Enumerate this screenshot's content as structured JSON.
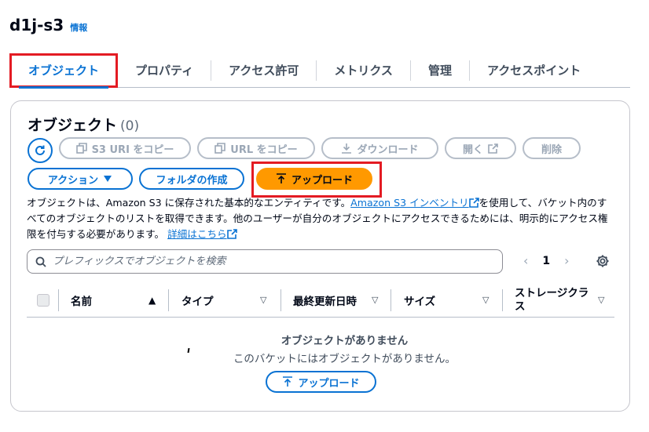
{
  "bucket": {
    "name": "d1j-s3",
    "info_label": "情報"
  },
  "tabs": [
    {
      "label": "オブジェクト",
      "active": true
    },
    {
      "label": "プロパティ"
    },
    {
      "label": "アクセス許可"
    },
    {
      "label": "メトリクス"
    },
    {
      "label": "管理"
    },
    {
      "label": "アクセスポイント"
    }
  ],
  "objects_panel": {
    "title": "オブジェクト",
    "count": "(0)",
    "buttons": {
      "copy_s3_uri": "S3 URI をコピー",
      "copy_url": "URL をコピー",
      "download": "ダウンロード",
      "open": "開く",
      "delete": "削除",
      "actions": "アクション",
      "create_folder": "フォルダの作成",
      "upload": "アップロード"
    },
    "description": {
      "part1": "オブジェクトは、Amazon S3 に保存された基本的なエンティティです。",
      "inventory_link": "Amazon S3 インベントリ",
      "part2": "を使用して、バケット内のすべてのオブジェクトのリストを取得できます。他のユーザーが自分のオブジェクトにアクセスできるためには、明示的にアクセス権限を付与する必要があります。",
      "learn_more_link": "詳細はこちら"
    },
    "search": {
      "placeholder": "プレフィックスでオブジェクトを検索"
    },
    "pagination": {
      "current_page": "1"
    },
    "columns": [
      "名前",
      "タイプ",
      "最終更新日時",
      "サイズ",
      "ストレージクラス"
    ],
    "empty_state": {
      "title": "オブジェクトがありません",
      "description": "このバケットにはオブジェクトがありません。",
      "upload_label": "アップロード"
    }
  },
  "colors": {
    "accent": "#0972d3",
    "primary_button": "#ff9900",
    "highlight_frame": "#e31b23"
  }
}
